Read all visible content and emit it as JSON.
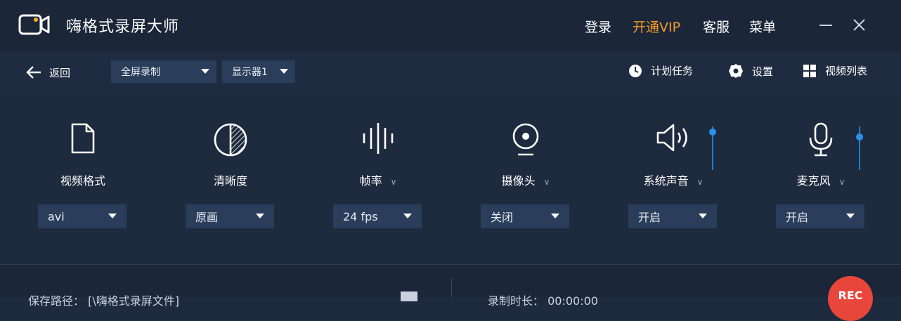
{
  "app": {
    "title": "嗨格式录屏大师"
  },
  "header": {
    "login": "登录",
    "vip": "开通VIP",
    "service": "客服",
    "menu": "菜单"
  },
  "toolbar": {
    "back": "返回",
    "mode": "全屏录制",
    "monitor": "显示器1",
    "schedule": "计划任务",
    "settings": "设置",
    "video_list": "视频列表"
  },
  "options": [
    {
      "label": "视频格式",
      "value": "avi",
      "has_menu": false
    },
    {
      "label": "清晰度",
      "value": "原画",
      "has_menu": false
    },
    {
      "label": "帧率",
      "value": "24 fps",
      "has_menu": true
    },
    {
      "label": "摄像头",
      "value": "关闭",
      "has_menu": true
    },
    {
      "label": "系统声音",
      "value": "开启",
      "has_menu": true,
      "volume": 0.95
    },
    {
      "label": "麦克风",
      "value": "开启",
      "has_menu": true,
      "volume": 0.8
    }
  ],
  "bottom": {
    "save_path": "保存路径： [\\嗨格式录屏文件]",
    "duration": "录制时长： 00:00:00",
    "rec_label": "REC"
  },
  "colors": {
    "accent": "#f39c28",
    "blue": "#2a92ee",
    "rec": "#e8463b",
    "bg": "#1e2a3e"
  }
}
